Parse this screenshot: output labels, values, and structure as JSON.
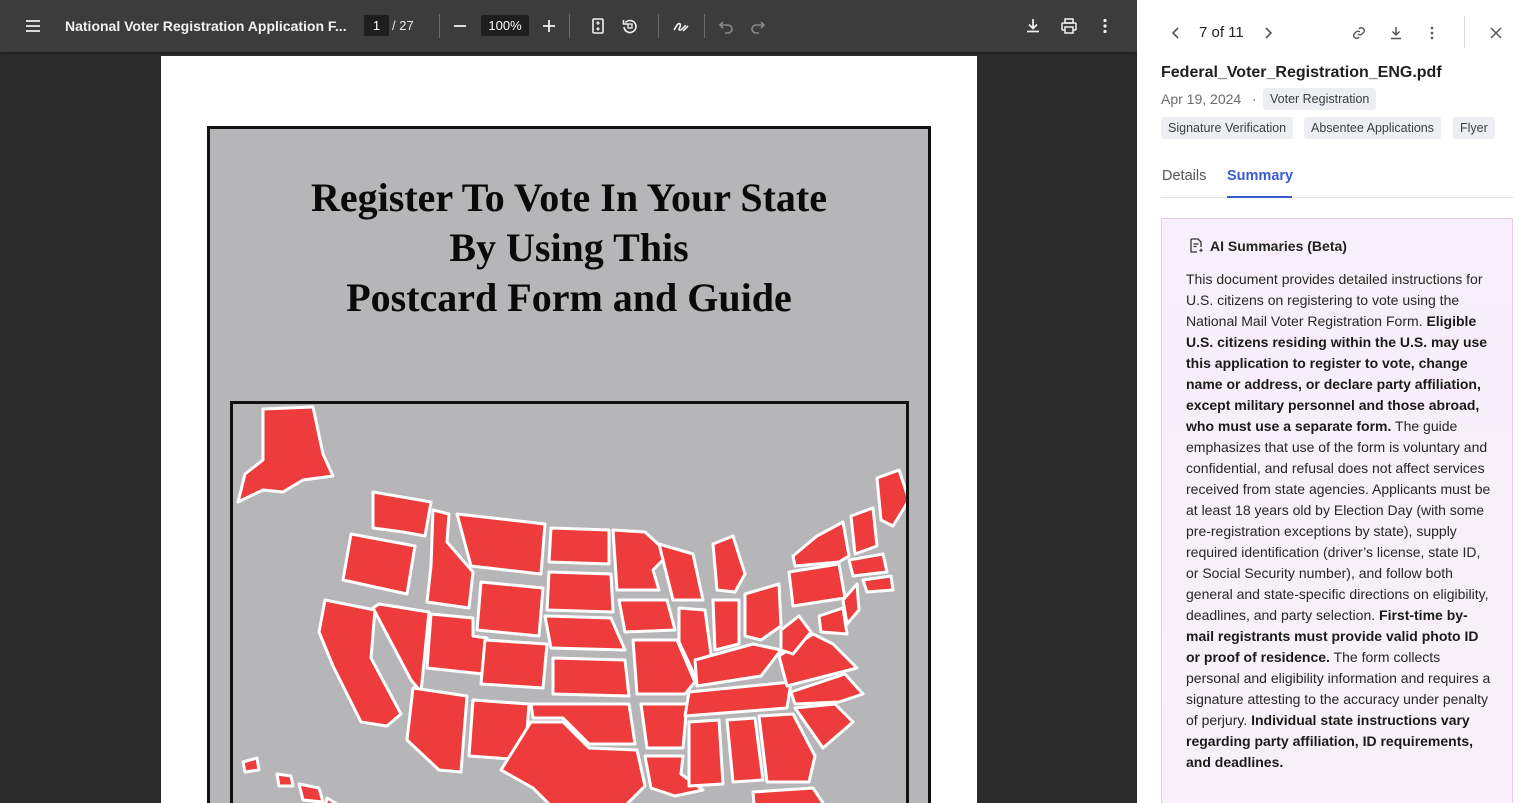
{
  "viewer": {
    "title": "National Voter Registration Application F...",
    "page_current": "1",
    "page_total": "/ 27",
    "zoom": "100%",
    "icons": [
      "menu-icon",
      "zoom-out-icon",
      "zoom-in-icon",
      "fit-page-icon",
      "rotate-icon",
      "annotate-icon",
      "undo-icon",
      "redo-icon",
      "download-icon",
      "print-icon",
      "more-vertical-icon"
    ]
  },
  "flyer": {
    "title_line1": "Register To Vote In Your State",
    "title_line2": "By Using This",
    "title_line3": "Postcard Form and Guide",
    "map_color": "#ee3b3b",
    "bg_color": "#b6b6b8"
  },
  "panel": {
    "counter": "7 of 11",
    "filename": "Federal_Voter_Registration_ENG.pdf",
    "date": "Apr 19, 2024",
    "separator": "·",
    "tags": [
      "Voter Registration",
      "Signature Verification",
      "Absentee Applications",
      "Flyer"
    ],
    "tabs": {
      "details": "Details",
      "summary": "Summary"
    },
    "summary_heading": "AI Summaries (Beta)",
    "summary": {
      "p1": "This document provides detailed instructions for U.S. citizens on registering to vote using the National Mail Voter Registration Form. ",
      "b1": "Eligible U.S. citizens residing within the U.S. may use this application to register to vote, change name or address, or declare party affiliation, except military personnel and those abroad, who must use a separate form.",
      "p2": " The guide emphasizes that use of the form is voluntary and confidential, and refusal does not affect services received from state agencies. Applicants must be at least 18 years old by Election Day (with some pre-registration exceptions by state), supply required identification (driver’s license, state ID, or Social Security number), and follow both general and state-specific directions on eligibility, deadlines, and party selection. ",
      "b2": "First-time by-mail registrants must provide valid photo ID or proof of residence.",
      "p3": " The form collects personal and eligibility information and requires a signature attesting to the accuracy under penalty of perjury. ",
      "b3": "Individual state instructions vary regarding party affiliation, ID requirements, and deadlines."
    },
    "accent_color": "#3b5bd0"
  }
}
